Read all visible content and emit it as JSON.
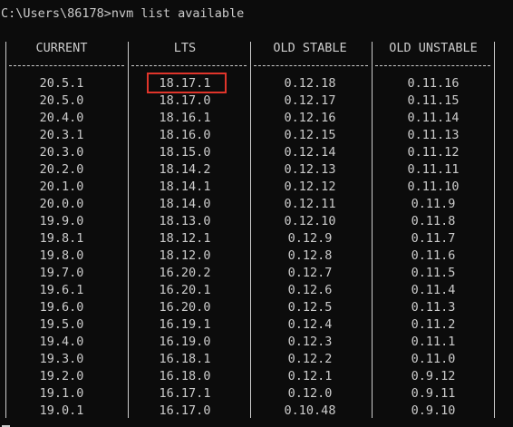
{
  "terminal": {
    "prompt": "C:\\Users\\86178>",
    "command": "nvm list available",
    "highlight_color": "#e0352b"
  },
  "table": {
    "headers": [
      "CURRENT",
      "LTS",
      "OLD STABLE",
      "OLD UNSTABLE"
    ],
    "rows": [
      [
        "20.5.1",
        "18.17.1",
        "0.12.18",
        "0.11.16"
      ],
      [
        "20.5.0",
        "18.17.0",
        "0.12.17",
        "0.11.15"
      ],
      [
        "20.4.0",
        "18.16.1",
        "0.12.16",
        "0.11.14"
      ],
      [
        "20.3.1",
        "18.16.0",
        "0.12.15",
        "0.11.13"
      ],
      [
        "20.3.0",
        "18.15.0",
        "0.12.14",
        "0.11.12"
      ],
      [
        "20.2.0",
        "18.14.2",
        "0.12.13",
        "0.11.11"
      ],
      [
        "20.1.0",
        "18.14.1",
        "0.12.12",
        "0.11.10"
      ],
      [
        "20.0.0",
        "18.14.0",
        "0.12.11",
        "0.11.9"
      ],
      [
        "19.9.0",
        "18.13.0",
        "0.12.10",
        "0.11.8"
      ],
      [
        "19.8.1",
        "18.12.1",
        "0.12.9",
        "0.11.7"
      ],
      [
        "19.8.0",
        "18.12.0",
        "0.12.8",
        "0.11.6"
      ],
      [
        "19.7.0",
        "16.20.2",
        "0.12.7",
        "0.11.5"
      ],
      [
        "19.6.1",
        "16.20.1",
        "0.12.6",
        "0.11.4"
      ],
      [
        "19.6.0",
        "16.20.0",
        "0.12.5",
        "0.11.3"
      ],
      [
        "19.5.0",
        "16.19.1",
        "0.12.4",
        "0.11.2"
      ],
      [
        "19.4.0",
        "16.19.0",
        "0.12.3",
        "0.11.1"
      ],
      [
        "19.3.0",
        "16.18.1",
        "0.12.2",
        "0.11.0"
      ],
      [
        "19.2.0",
        "16.18.0",
        "0.12.1",
        "0.9.12"
      ],
      [
        "19.1.0",
        "16.17.1",
        "0.12.0",
        "0.9.11"
      ],
      [
        "19.0.1",
        "16.17.0",
        "0.10.48",
        "0.9.10"
      ]
    ],
    "highlighted_cell": "18.17.1"
  }
}
